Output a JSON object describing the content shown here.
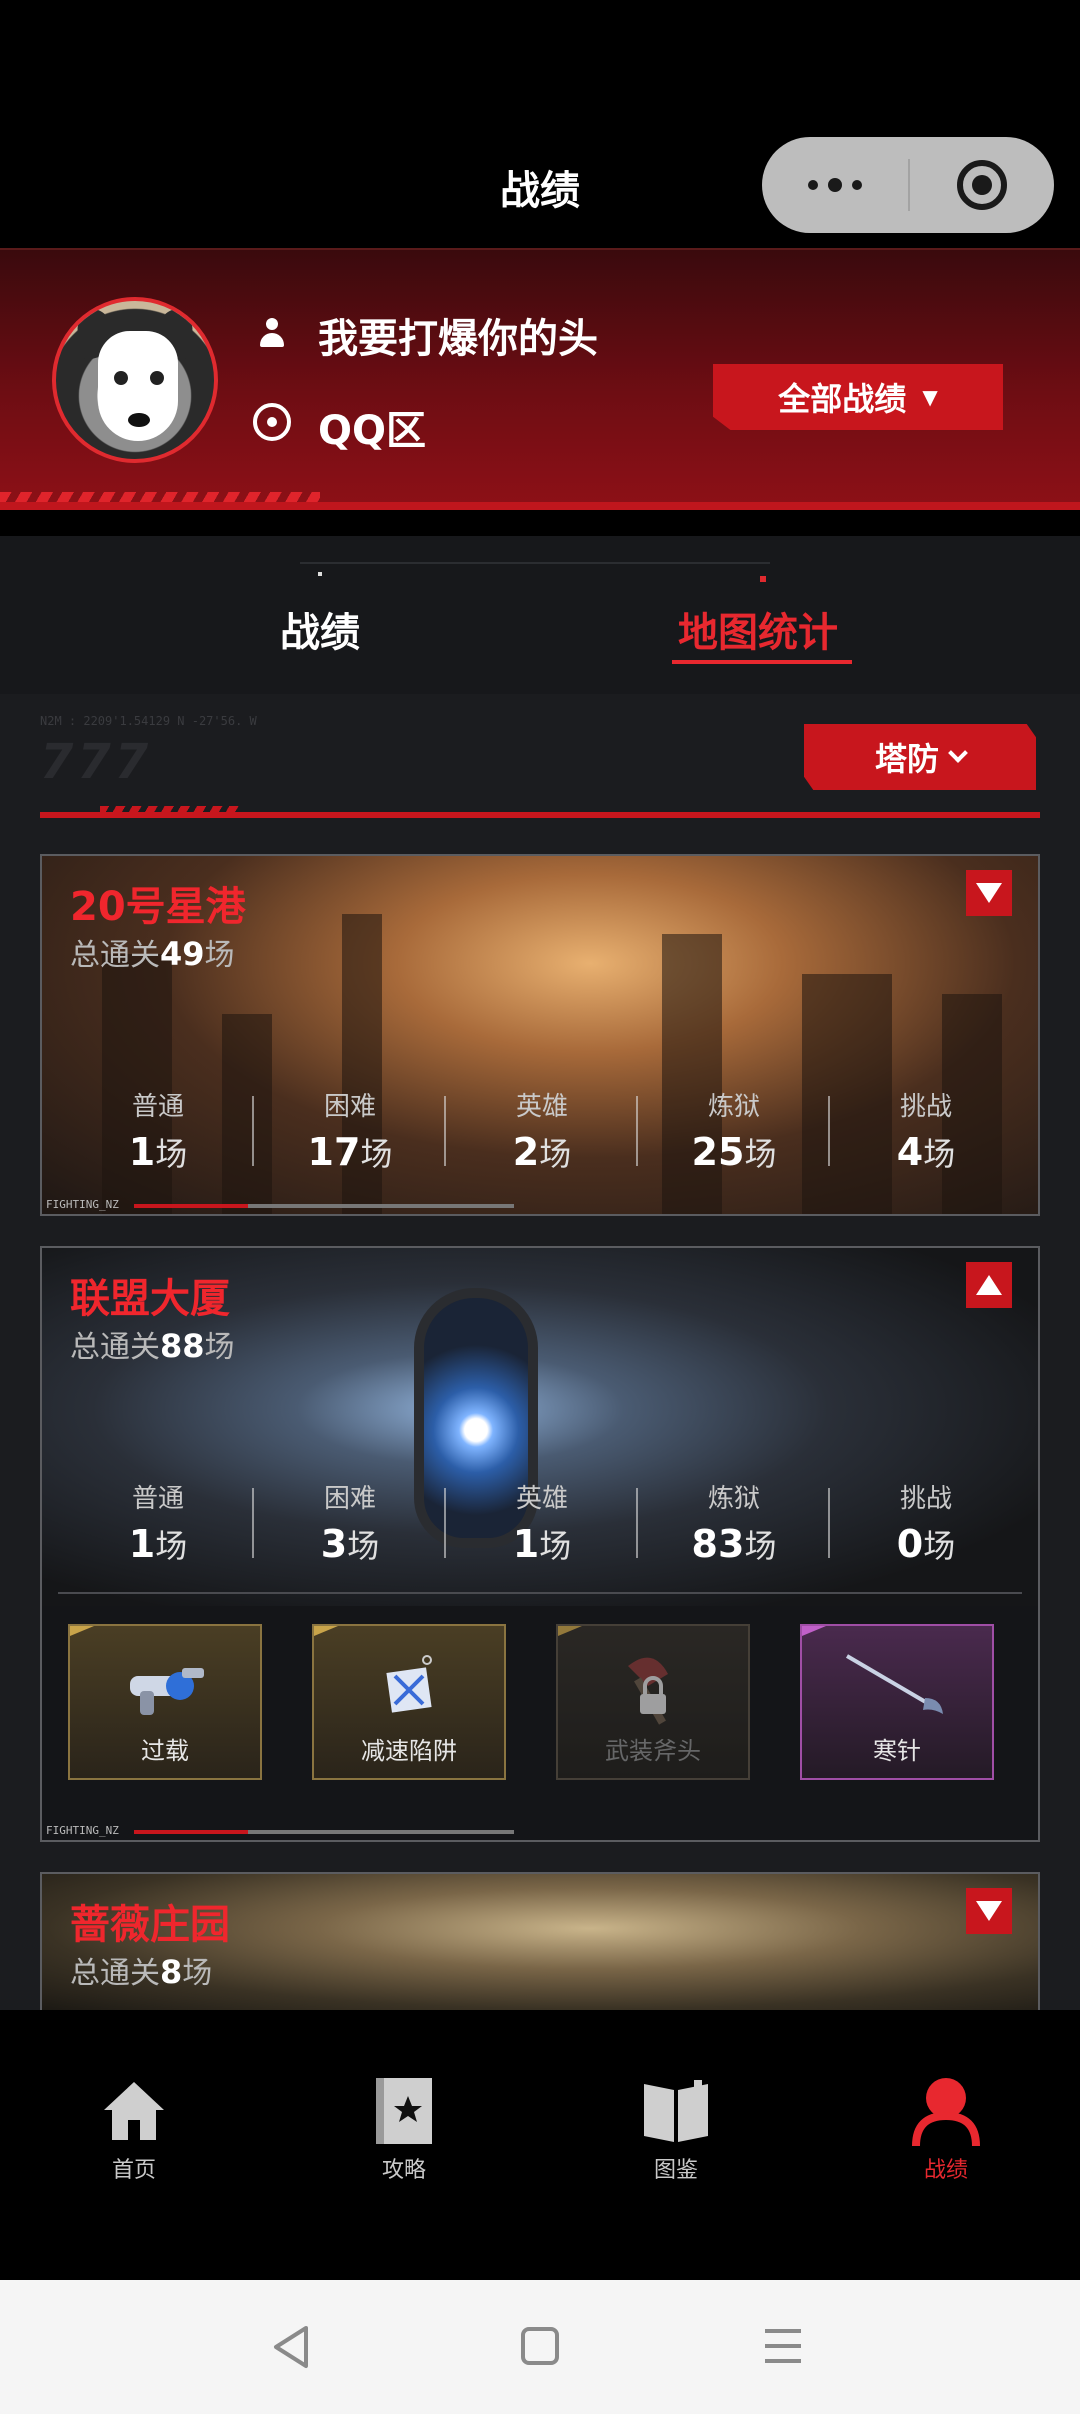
{
  "header": {
    "title": "战绩"
  },
  "profile": {
    "username": "我要打爆你的头",
    "server": "QQ区",
    "filter_button": "全部战绩",
    "filter_caret": "▼"
  },
  "tabs": [
    {
      "label": "战绩",
      "active": false
    },
    {
      "label": "地图统计",
      "active": true
    }
  ],
  "mode_filter": {
    "label": "塔防"
  },
  "decor": {
    "code": "N2M : 2209'1.54129 N -27'56. W",
    "mark": "777",
    "tag": "FIGHTING_NZ"
  },
  "maps": [
    {
      "name": "20号星港",
      "total_prefix": "总通关",
      "total": "49",
      "total_unit": "场",
      "expanded": false,
      "stats": [
        {
          "label": "普通",
          "value": "1",
          "unit": "场"
        },
        {
          "label": "困难",
          "value": "17",
          "unit": "场"
        },
        {
          "label": "英雄",
          "value": "2",
          "unit": "场"
        },
        {
          "label": "炼狱",
          "value": "25",
          "unit": "场"
        },
        {
          "label": "挑战",
          "value": "4",
          "unit": "场"
        }
      ]
    },
    {
      "name": "联盟大厦",
      "total_prefix": "总通关",
      "total": "88",
      "total_unit": "场",
      "expanded": true,
      "stats": [
        {
          "label": "普通",
          "value": "1",
          "unit": "场"
        },
        {
          "label": "困难",
          "value": "3",
          "unit": "场"
        },
        {
          "label": "英雄",
          "value": "1",
          "unit": "场"
        },
        {
          "label": "炼狱",
          "value": "83",
          "unit": "场"
        },
        {
          "label": "挑战",
          "value": "0",
          "unit": "场"
        }
      ],
      "items": [
        {
          "name": "过载",
          "locked": false,
          "rarity": "gold",
          "icon": "gun-icon"
        },
        {
          "name": "减速陷阱",
          "locked": false,
          "rarity": "gold",
          "icon": "trap-icon"
        },
        {
          "name": "武装斧头",
          "locked": true,
          "rarity": "gold",
          "icon": "axe-icon"
        },
        {
          "name": "寒针",
          "locked": false,
          "rarity": "purple",
          "icon": "sword-icon"
        }
      ]
    },
    {
      "name": "蔷薇庄园",
      "total_prefix": "总通关",
      "total": "8",
      "total_unit": "场",
      "expanded": false
    }
  ],
  "bottom_nav": [
    {
      "label": "首页",
      "icon": "home-icon",
      "active": false
    },
    {
      "label": "攻略",
      "icon": "guide-icon",
      "active": false
    },
    {
      "label": "图鉴",
      "icon": "book-icon",
      "active": false
    },
    {
      "label": "战绩",
      "icon": "profile-icon",
      "active": true
    }
  ],
  "colors": {
    "accent": "#e8282f",
    "banner": "#8e1017",
    "background": "#1b1c1f"
  }
}
